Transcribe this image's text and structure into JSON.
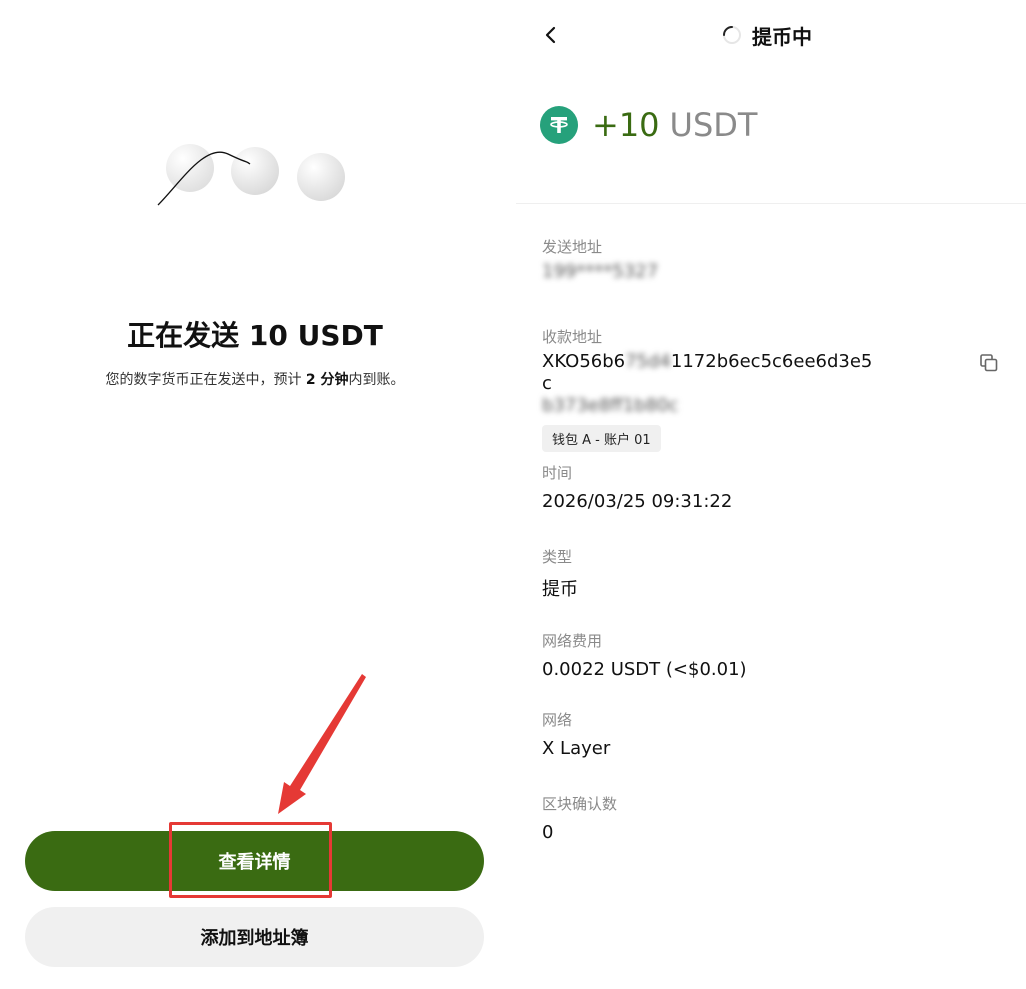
{
  "left": {
    "title": "正在发送 10 USDT",
    "subtitle_prefix": "您的数字货币正在发送中，预计 ",
    "subtitle_bold": "2 分钟",
    "subtitle_suffix": "内到账。",
    "primary_button": "查看详情",
    "secondary_button": "添加到地址簿"
  },
  "header": {
    "title": "提币中"
  },
  "amount": {
    "value": "+10",
    "unit": "USDT"
  },
  "details": {
    "sender_label": "发送地址",
    "sender_value": "199****5327",
    "recipient_label": "收款地址",
    "recipient_line1_clear": "XKO56b6",
    "recipient_line1_blur": "75d4",
    "recipient_line1_rest": "1172b6ec5c6ee6d3e5c",
    "recipient_line2": "b373e8ff1b80c",
    "wallet_tag": "钱包 A - 账户 01",
    "time_label": "时间",
    "time_value": "2026/03/25 09:31:22",
    "type_label": "类型",
    "type_value": "提币",
    "fee_label": "网络费用",
    "fee_value": "0.0022 USDT (<$0.01)",
    "network_label": "网络",
    "network_value": "X Layer",
    "confirm_label": "区块确认数",
    "confirm_value": "0"
  },
  "colors": {
    "brand_green": "#3a6b12",
    "usdt_teal": "#26a17b",
    "annotation_red": "#e53935"
  }
}
